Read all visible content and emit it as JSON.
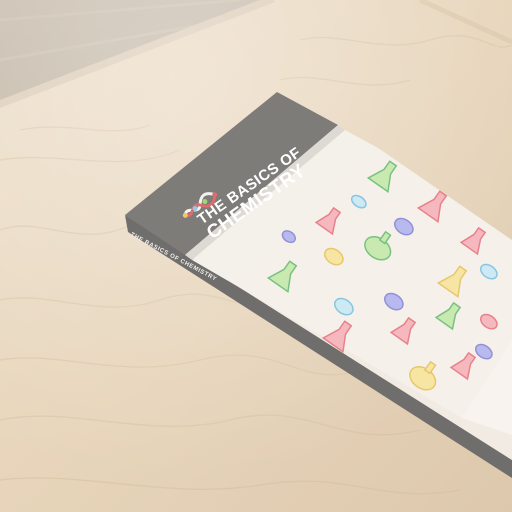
{
  "book": {
    "title_line1": "THE BASICS OF",
    "title_line2": "CHEMISTRY",
    "spine_title": "THE BASICS OF CHEMISTRY"
  },
  "colors": {
    "table": "#e2ccae",
    "floor": "#b3a48f",
    "cover_band": "#6d6a67",
    "cover_page": "#f3eee6"
  }
}
